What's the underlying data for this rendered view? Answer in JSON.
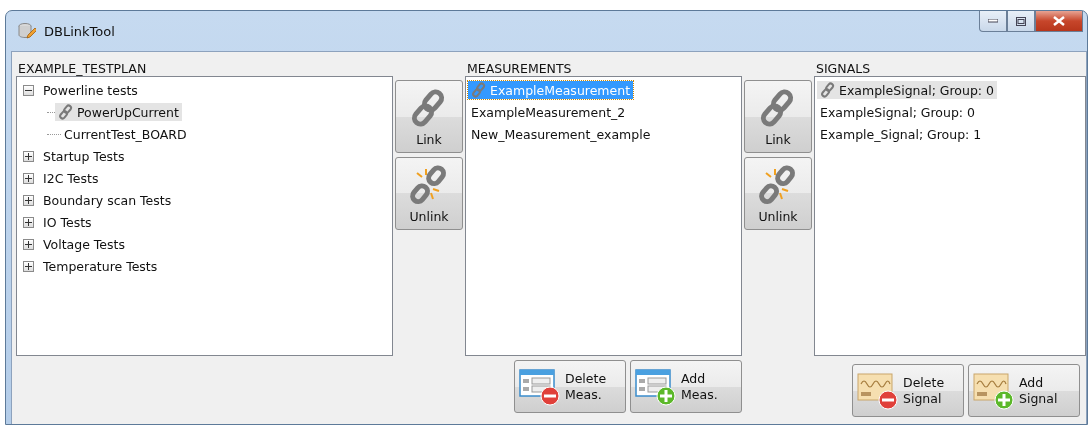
{
  "window": {
    "title": "DBLinkTool"
  },
  "testplan": {
    "heading": "EXAMPLE_TESTPLAN",
    "tree": [
      {
        "label": "Powerline tests",
        "expanded": true,
        "linked": false,
        "selected": false,
        "children": [
          {
            "label": "PowerUpCurrent",
            "linked": true,
            "selected": true
          },
          {
            "label": "CurrentTest_BOARD",
            "linked": false,
            "selected": false
          }
        ]
      },
      {
        "label": "Startup Tests",
        "expanded": false,
        "linked": false,
        "selected": false
      },
      {
        "label": "I2C Tests",
        "expanded": false,
        "linked": false,
        "selected": false
      },
      {
        "label": "Boundary scan Tests",
        "expanded": false,
        "linked": false,
        "selected": false
      },
      {
        "label": "IO Tests",
        "expanded": false,
        "linked": false,
        "selected": false
      },
      {
        "label": "Voltage Tests",
        "expanded": false,
        "linked": false,
        "selected": false
      },
      {
        "label": "Temperature Tests",
        "expanded": false,
        "linked": false,
        "selected": false
      }
    ]
  },
  "link_buttons_1": [
    {
      "kind": "link",
      "label": "Link"
    },
    {
      "kind": "unlink",
      "label": "Unlink"
    }
  ],
  "measurements": {
    "heading": "MEASUREMENTS",
    "items": [
      {
        "label": "ExampleMeasurement",
        "linked": true,
        "selected": true,
        "focused": true
      },
      {
        "label": "ExampleMeasurement_2",
        "linked": false,
        "selected": false,
        "focused": false
      },
      {
        "label": "New_Measurement_example",
        "linked": false,
        "selected": false,
        "focused": false
      }
    ],
    "buttons": [
      {
        "kind": "delete_form",
        "label": "Delete",
        "label2": "Meas."
      },
      {
        "kind": "add_form",
        "label": "Add",
        "label2": "Meas."
      }
    ]
  },
  "link_buttons_2": [
    {
      "kind": "link",
      "label": "Link"
    },
    {
      "kind": "unlink",
      "label": "Unlink"
    }
  ],
  "signals": {
    "heading": "SIGNALS",
    "items": [
      {
        "label": "ExampleSignal;  Group: 0",
        "linked": true,
        "selected": true,
        "focused": false
      },
      {
        "label": "ExampleSignal;  Group: 0",
        "linked": false,
        "selected": false,
        "focused": false
      },
      {
        "label": "Example_Signal;  Group: 1",
        "linked": false,
        "selected": false,
        "focused": false
      }
    ],
    "buttons": [
      {
        "kind": "delete_signal",
        "label": "Delete",
        "label2": "Signal"
      },
      {
        "kind": "add_signal",
        "label": "Add",
        "label2": "Signal"
      }
    ]
  }
}
